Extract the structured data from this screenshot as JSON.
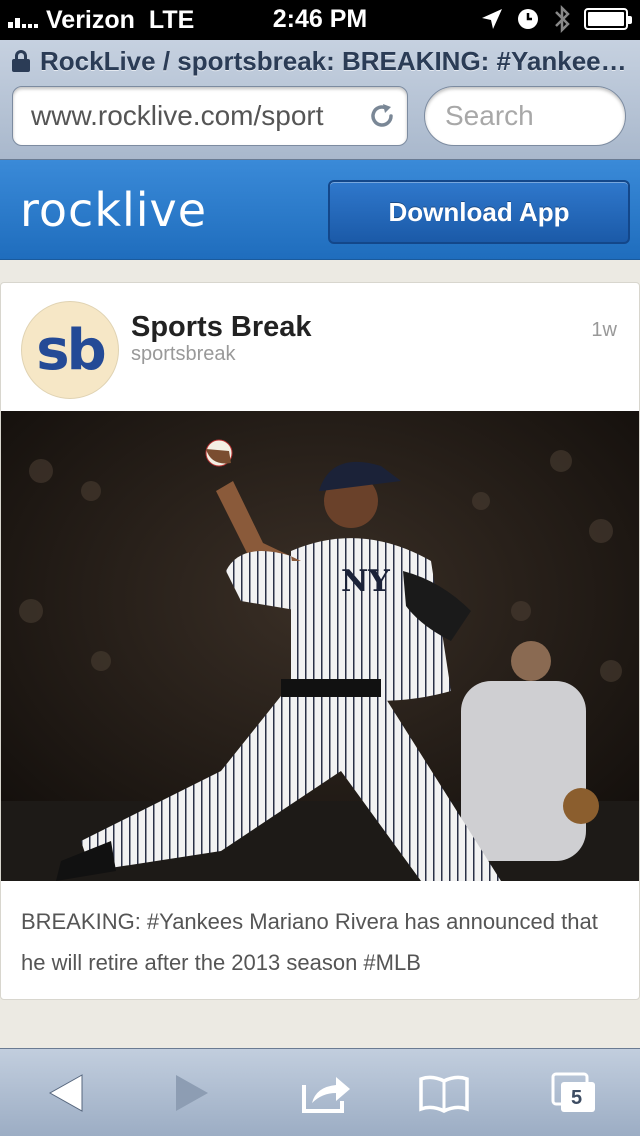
{
  "status_bar": {
    "carrier": "Verizon",
    "network": "LTE",
    "time": "2:46 PM"
  },
  "browser": {
    "page_title": "RockLive / sportsbreak: BREAKING: #Yankee…",
    "url": "www.rocklive.com/sport",
    "search_placeholder": "Search",
    "tab_count": "5"
  },
  "app_header": {
    "brand": "rocklive",
    "download_label": "Download App"
  },
  "post": {
    "avatar_initials": "sb",
    "author_name": "Sports Break",
    "author_handle": "sportsbreak",
    "age": "1w",
    "text": "BREAKING: #Yankees Mariano Rivera has announced that he will retire after the 2013 season #MLB"
  },
  "colors": {
    "header_blue": "#2a7bd0",
    "avatar_bg": "#f6e7c6",
    "avatar_text": "#244a96"
  },
  "icons": [
    "lock-icon",
    "reload-icon",
    "back-icon",
    "forward-icon",
    "share-icon",
    "bookmarks-icon",
    "tabs-icon"
  ]
}
